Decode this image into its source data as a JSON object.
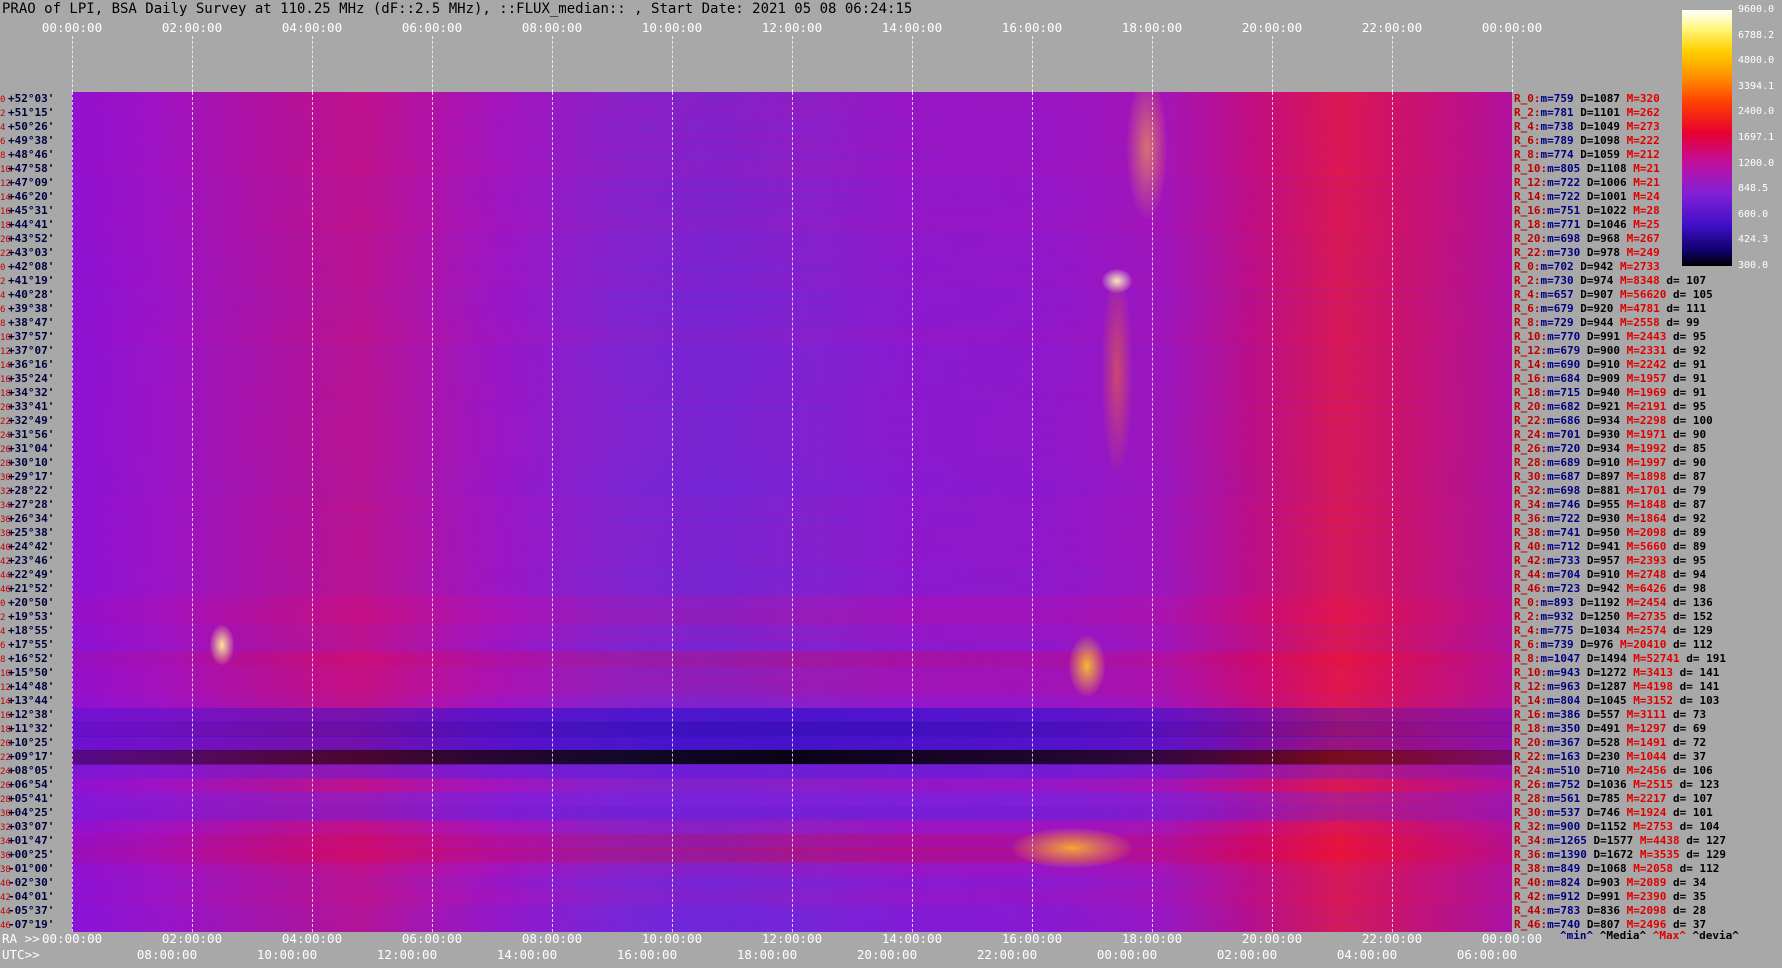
{
  "title": "PRAO of LPI, BSA Daily Survey at 110.25 MHz (dF::2.5 MHz), ::FLUX_median:: , Start Date: 2021 05 08 06:24:15",
  "top_ticks": [
    "00:00:00",
    "02:00:00",
    "04:00:00",
    "06:00:00",
    "08:00:00",
    "10:00:00",
    "12:00:00",
    "14:00:00",
    "16:00:00",
    "18:00:00",
    "20:00:00",
    "22:00:00",
    "00:00:00"
  ],
  "bottom": {
    "ra_label": "RA >>",
    "utc_label": "UTC>>",
    "ra_ticks": [
      "00:00:00",
      "02:00:00",
      "04:00:00",
      "06:00:00",
      "08:00:00",
      "10:00:00",
      "12:00:00",
      "14:00:00",
      "16:00:00",
      "18:00:00",
      "20:00:00",
      "22:00:00",
      "00:00:00"
    ],
    "utc_ticks": [
      "08:00:00",
      "10:00:00",
      "12:00:00",
      "14:00:00",
      "16:00:00",
      "18:00:00",
      "20:00:00",
      "22:00:00",
      "00:00:00",
      "02:00:00",
      "04:00:00",
      "06:00:00"
    ]
  },
  "colorbar": {
    "labels": [
      "9600.0",
      "6788.2",
      "4800.0",
      "3394.1",
      "2400.0",
      "1697.1",
      "1200.0",
      "848.5",
      "600.0",
      "424.3",
      "300.0"
    ]
  },
  "footer": {
    "min": "^min^",
    "median": "^Media^",
    "max": "^Max^",
    "devia": "^devia^"
  },
  "chart_data": {
    "type": "heatmap",
    "title": "PRAO of LPI, BSA Daily Survey at 110.25 MHz (dF::2.5 MHz), ::FLUX_median:: , Start Date: 2021 05 08 06:24:15",
    "x_axis": "RA / UTC",
    "rows": [
      {
        "i": "0",
        "dec": "+52°03'"
      },
      {
        "i": "2",
        "dec": "+51°15'"
      },
      {
        "i": "4",
        "dec": "+50°26'"
      },
      {
        "i": "6",
        "dec": "+49°38'"
      },
      {
        "i": "8",
        "dec": "+48°46'"
      },
      {
        "i": "10",
        "dec": "+47°58'"
      },
      {
        "i": "12",
        "dec": "+47°09'"
      },
      {
        "i": "14",
        "dec": "+46°20'"
      },
      {
        "i": "16",
        "dec": "+45°31'"
      },
      {
        "i": "18",
        "dec": "+44°41'"
      },
      {
        "i": "20",
        "dec": "+43°52'"
      },
      {
        "i": "22",
        "dec": "+43°03'"
      },
      {
        "i": "0",
        "dec": "+42°08'"
      },
      {
        "i": "2",
        "dec": "+41°19'"
      },
      {
        "i": "4",
        "dec": "+40°28'"
      },
      {
        "i": "6",
        "dec": "+39°38'"
      },
      {
        "i": "8",
        "dec": "+38°47'"
      },
      {
        "i": "10",
        "dec": "+37°57'"
      },
      {
        "i": "12",
        "dec": "+37°07'"
      },
      {
        "i": "14",
        "dec": "+36°16'"
      },
      {
        "i": "16",
        "dec": "+35°24'"
      },
      {
        "i": "18",
        "dec": "+34°32'"
      },
      {
        "i": "20",
        "dec": "+33°41'"
      },
      {
        "i": "22",
        "dec": "+32°49'"
      },
      {
        "i": "24",
        "dec": "+31°56'"
      },
      {
        "i": "26",
        "dec": "+31°04'"
      },
      {
        "i": "28",
        "dec": "+30°10'"
      },
      {
        "i": "30",
        "dec": "+29°17'"
      },
      {
        "i": "32",
        "dec": "+28°22'"
      },
      {
        "i": "34",
        "dec": "+27°28'"
      },
      {
        "i": "36",
        "dec": "+26°34'"
      },
      {
        "i": "38",
        "dec": "+25°38'"
      },
      {
        "i": "40",
        "dec": "+24°42'"
      },
      {
        "i": "42",
        "dec": "+23°46'"
      },
      {
        "i": "44",
        "dec": "+22°49'"
      },
      {
        "i": "46",
        "dec": "+21°52'"
      },
      {
        "i": "0",
        "dec": "+20°50'"
      },
      {
        "i": "2",
        "dec": "+19°53'"
      },
      {
        "i": "4",
        "dec": "+18°55'"
      },
      {
        "i": "6",
        "dec": "+17°55'"
      },
      {
        "i": "8",
        "dec": "+16°52'"
      },
      {
        "i": "10",
        "dec": "+15°50'"
      },
      {
        "i": "12",
        "dec": "+14°48'"
      },
      {
        "i": "14",
        "dec": "+13°44'"
      },
      {
        "i": "16",
        "dec": "+12°38'"
      },
      {
        "i": "18",
        "dec": "+11°32'"
      },
      {
        "i": "20",
        "dec": "+10°25'"
      },
      {
        "i": "22",
        "dec": "+09°17'"
      },
      {
        "i": "24",
        "dec": "+08°05'"
      },
      {
        "i": "26",
        "dec": "+06°54'"
      },
      {
        "i": "28",
        "dec": "+05°41'"
      },
      {
        "i": "30",
        "dec": "+04°25'"
      },
      {
        "i": "32",
        "dec": "+03°07'"
      },
      {
        "i": "34",
        "dec": "+01°47'"
      },
      {
        "i": "36",
        "dec": "+00°25'"
      },
      {
        "i": "38",
        "dec": "-01°00'"
      },
      {
        "i": "40",
        "dec": "-02°30'"
      },
      {
        "i": "42",
        "dec": "-04°01'"
      },
      {
        "i": "44",
        "dec": "-05°37'"
      },
      {
        "i": "46",
        "dec": "-07°19'"
      }
    ],
    "stats": [
      {
        "r": "R_0:",
        "m": "759",
        "D": "1087",
        "M": "320",
        "d": ""
      },
      {
        "r": "R_2:",
        "m": "781",
        "D": "1101",
        "M": "262",
        "d": ""
      },
      {
        "r": "R_4:",
        "m": "738",
        "D": "1049",
        "M": "273",
        "d": ""
      },
      {
        "r": "R_6:",
        "m": "789",
        "D": "1098",
        "M": "222",
        "d": ""
      },
      {
        "r": "R_8:",
        "m": "774",
        "D": "1059",
        "M": "212",
        "d": ""
      },
      {
        "r": "R_10:",
        "m": "805",
        "D": "1108",
        "M": "21",
        "d": ""
      },
      {
        "r": "R_12:",
        "m": "722",
        "D": "1006",
        "M": "21",
        "d": ""
      },
      {
        "r": "R_14:",
        "m": "722",
        "D": "1001",
        "M": "24",
        "d": ""
      },
      {
        "r": "R_16:",
        "m": "751",
        "D": "1022",
        "M": "28",
        "d": ""
      },
      {
        "r": "R_18:",
        "m": "771",
        "D": "1046",
        "M": "25",
        "d": ""
      },
      {
        "r": "R_20:",
        "m": "698",
        "D": "968",
        "M": "267",
        "d": ""
      },
      {
        "r": "R_22:",
        "m": "730",
        "D": "978",
        "M": "249",
        "d": ""
      },
      {
        "r": "R_0:",
        "m": "702",
        "D": "942",
        "M": "2733",
        "d": ""
      },
      {
        "r": "R_2:",
        "m": "730",
        "D": "974",
        "M": "8348",
        "d": "107"
      },
      {
        "r": "R_4:",
        "m": "657",
        "D": "907",
        "M": "56620",
        "d": "105"
      },
      {
        "r": "R_6:",
        "m": "679",
        "D": "920",
        "M": "4781",
        "d": "111"
      },
      {
        "r": "R_8:",
        "m": "729",
        "D": "944",
        "M": "2558",
        "d": "99"
      },
      {
        "r": "R_10:",
        "m": "770",
        "D": "991",
        "M": "2443",
        "d": "95"
      },
      {
        "r": "R_12:",
        "m": "679",
        "D": "900",
        "M": "2331",
        "d": "92"
      },
      {
        "r": "R_14:",
        "m": "690",
        "D": "910",
        "M": "2242",
        "d": "91"
      },
      {
        "r": "R_16:",
        "m": "684",
        "D": "909",
        "M": "1957",
        "d": "91"
      },
      {
        "r": "R_18:",
        "m": "715",
        "D": "940",
        "M": "1969",
        "d": "91"
      },
      {
        "r": "R_20:",
        "m": "682",
        "D": "921",
        "M": "2191",
        "d": "95"
      },
      {
        "r": "R_22:",
        "m": "686",
        "D": "934",
        "M": "2298",
        "d": "100"
      },
      {
        "r": "R_24:",
        "m": "701",
        "D": "930",
        "M": "1971",
        "d": "90"
      },
      {
        "r": "R_26:",
        "m": "720",
        "D": "934",
        "M": "1992",
        "d": "85"
      },
      {
        "r": "R_28:",
        "m": "689",
        "D": "910",
        "M": "1997",
        "d": "90"
      },
      {
        "r": "R_30:",
        "m": "687",
        "D": "897",
        "M": "1898",
        "d": "87"
      },
      {
        "r": "R_32:",
        "m": "698",
        "D": "881",
        "M": "1701",
        "d": "79"
      },
      {
        "r": "R_34:",
        "m": "746",
        "D": "955",
        "M": "1848",
        "d": "87"
      },
      {
        "r": "R_36:",
        "m": "722",
        "D": "930",
        "M": "1864",
        "d": "92"
      },
      {
        "r": "R_38:",
        "m": "741",
        "D": "950",
        "M": "2098",
        "d": "89"
      },
      {
        "r": "R_40:",
        "m": "712",
        "D": "941",
        "M": "5660",
        "d": "89"
      },
      {
        "r": "R_42:",
        "m": "733",
        "D": "957",
        "M": "2393",
        "d": "95"
      },
      {
        "r": "R_44:",
        "m": "704",
        "D": "910",
        "M": "2748",
        "d": "94"
      },
      {
        "r": "R_46:",
        "m": "723",
        "D": "942",
        "M": "6426",
        "d": "98"
      },
      {
        "r": "R_0:",
        "m": "893",
        "D": "1192",
        "M": "2454",
        "d": "136"
      },
      {
        "r": "R_2:",
        "m": "932",
        "D": "1250",
        "M": "2735",
        "d": "152"
      },
      {
        "r": "R_4:",
        "m": "775",
        "D": "1034",
        "M": "2574",
        "d": "129"
      },
      {
        "r": "R_6:",
        "m": "739",
        "D": "976",
        "M": "20410",
        "d": "112"
      },
      {
        "r": "R_8:",
        "m": "1047",
        "D": "1494",
        "M": "52741",
        "d": "191"
      },
      {
        "r": "R_10:",
        "m": "943",
        "D": "1272",
        "M": "3413",
        "d": "141"
      },
      {
        "r": "R_12:",
        "m": "963",
        "D": "1287",
        "M": "4198",
        "d": "141"
      },
      {
        "r": "R_14:",
        "m": "804",
        "D": "1045",
        "M": "3152",
        "d": "103"
      },
      {
        "r": "R_16:",
        "m": "386",
        "D": "557",
        "M": "3111",
        "d": "73"
      },
      {
        "r": "R_18:",
        "m": "350",
        "D": "491",
        "M": "1297",
        "d": "69"
      },
      {
        "r": "R_20:",
        "m": "367",
        "D": "528",
        "M": "1491",
        "d": "72"
      },
      {
        "r": "R_22:",
        "m": "163",
        "D": "230",
        "M": "1044",
        "d": "37"
      },
      {
        "r": "R_24:",
        "m": "510",
        "D": "710",
        "M": "2456",
        "d": "106"
      },
      {
        "r": "R_26:",
        "m": "752",
        "D": "1036",
        "M": "2515",
        "d": "123"
      },
      {
        "r": "R_28:",
        "m": "561",
        "D": "785",
        "M": "2217",
        "d": "107"
      },
      {
        "r": "R_30:",
        "m": "537",
        "D": "746",
        "M": "1924",
        "d": "101"
      },
      {
        "r": "R_32:",
        "m": "900",
        "D": "1152",
        "M": "2753",
        "d": "104"
      },
      {
        "r": "R_34:",
        "m": "1265",
        "D": "1577",
        "M": "4438",
        "d": "127"
      },
      {
        "r": "R_36:",
        "m": "1390",
        "D": "1672",
        "M": "3535",
        "d": "129"
      },
      {
        "r": "R_38:",
        "m": "849",
        "D": "1068",
        "M": "2058",
        "d": "112"
      },
      {
        "r": "R_40:",
        "m": "824",
        "D": "903",
        "M": "2089",
        "d": "34"
      },
      {
        "r": "R_42:",
        "m": "912",
        "D": "991",
        "M": "2390",
        "d": "35"
      },
      {
        "r": "R_44:",
        "m": "783",
        "D": "836",
        "M": "2098",
        "d": "28"
      },
      {
        "r": "R_46:",
        "m": "740",
        "D": "807",
        "M": "2496",
        "d": "37"
      }
    ]
  }
}
